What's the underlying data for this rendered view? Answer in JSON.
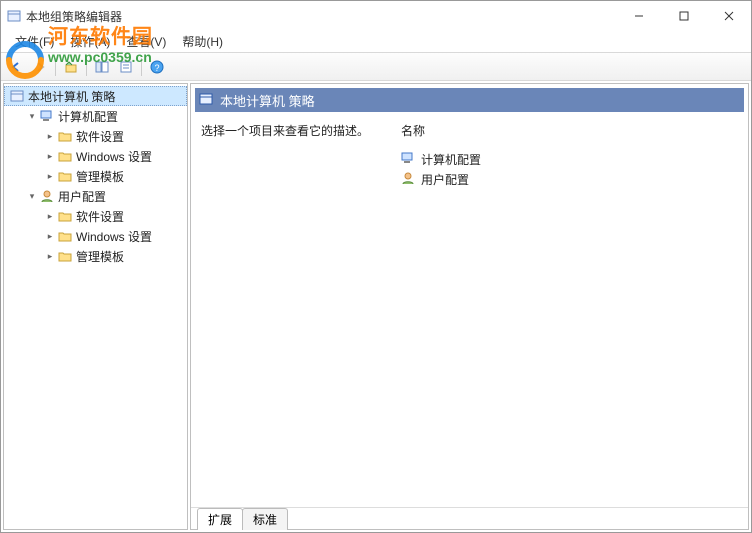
{
  "window": {
    "title": "本地组策略编辑器"
  },
  "menu": {
    "file": "文件(F)",
    "action": "操作(A)",
    "view": "查看(V)",
    "help": "帮助(H)"
  },
  "tree": {
    "root": "本地计算机 策略",
    "computer": "计算机配置",
    "user": "用户配置",
    "soft": "软件设置",
    "win": "Windows 设置",
    "tpl": "管理模板"
  },
  "main": {
    "heading": "本地计算机 策略",
    "description": "选择一个项目来查看它的描述。",
    "column_name": "名称",
    "items": {
      "computer": "计算机配置",
      "user": "用户配置"
    }
  },
  "tabs": {
    "extended": "扩展",
    "standard": "标准"
  },
  "watermark": {
    "brand": "河东软件园",
    "url": "www.pc0359.cn"
  }
}
